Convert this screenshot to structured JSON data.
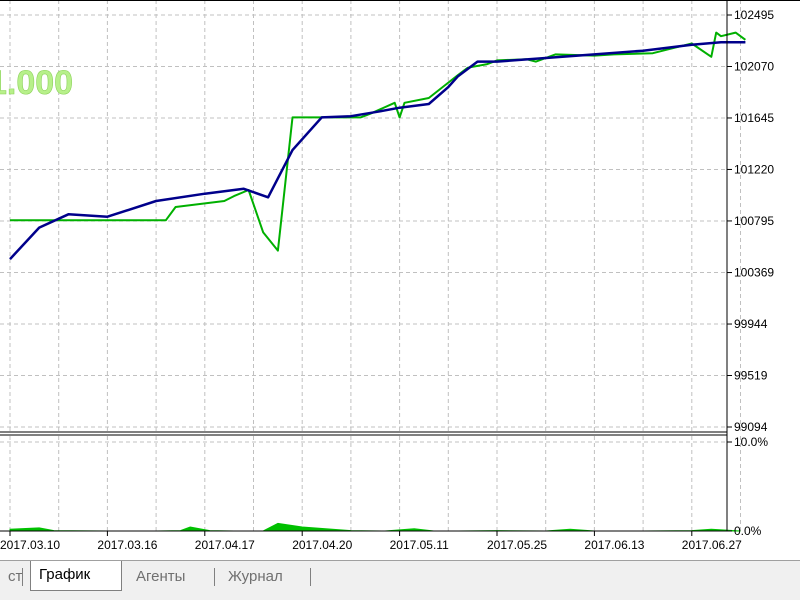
{
  "chart_data": {
    "type": "line",
    "balance_label": "1.000",
    "y_ticks": [
      "102495",
      "102070",
      "101645",
      "101220",
      "100795",
      "100369",
      "99944",
      "99519",
      "99094"
    ],
    "ylim": [
      99094,
      102495
    ],
    "x_ticks": [
      "2017.03.10",
      "2017.03.16",
      "2017.04.17",
      "2017.04.20",
      "2017.05.11",
      "2017.05.25",
      "2017.06.13",
      "2017.06.27"
    ],
    "series": [
      {
        "color": "#00b000",
        "x": [
          0,
          0.5,
          1.0,
          1.6,
          1.7,
          2.2,
          2.3,
          2.45,
          2.6,
          2.75,
          2.9,
          3.0,
          3.2,
          3.5,
          3.6,
          3.7,
          3.95,
          4.0,
          4.05,
          4.3,
          4.6,
          4.7,
          4.9,
          5.0,
          5.3,
          5.4,
          5.6,
          6.0,
          6.2,
          6.6,
          6.8,
          7.0,
          7.2,
          7.25,
          7.3,
          7.45,
          7.55
        ],
        "y": [
          100800,
          100800,
          100800,
          100800,
          100910,
          100960,
          101000,
          101050,
          100700,
          100550,
          101650,
          101650,
          101650,
          101650,
          101650,
          101680,
          101770,
          101650,
          101770,
          101810,
          102000,
          102060,
          102090,
          102120,
          102130,
          102110,
          102170,
          102160,
          102170,
          102180,
          102220,
          102260,
          102150,
          102350,
          102320,
          102350,
          102290
        ]
      },
      {
        "color": "#00008b",
        "x": [
          0,
          0.3,
          0.6,
          1.0,
          1.5,
          2.0,
          2.4,
          2.65,
          2.9,
          3.2,
          3.5,
          3.8,
          4.0,
          4.3,
          4.5,
          4.6,
          4.8,
          5.0,
          5.5,
          6.0,
          6.5,
          7.0,
          7.3,
          7.55
        ],
        "y": [
          100480,
          100740,
          100850,
          100830,
          100960,
          101020,
          101060,
          100990,
          101380,
          101650,
          101660,
          101700,
          101730,
          101760,
          101900,
          101990,
          102110,
          102110,
          102140,
          102170,
          102200,
          102250,
          102270,
          102270
        ]
      }
    ],
    "drawdown": {
      "y_ticks": [
        "10.0%",
        "0.0%"
      ],
      "ylim": [
        0,
        10
      ],
      "color": "#00c000",
      "x": [
        0,
        0.3,
        0.45,
        1.0,
        1.5,
        1.75,
        1.85,
        2.05,
        2.3,
        2.6,
        2.75,
        3.0,
        3.5,
        3.85,
        4.15,
        4.35,
        4.6,
        5.0,
        5.5,
        5.75,
        6.0,
        6.5,
        7.0,
        7.2,
        7.5
      ],
      "y": [
        0.2,
        0.35,
        0.05,
        0.0,
        0.0,
        0.05,
        0.45,
        0.05,
        0.0,
        0.0,
        0.85,
        0.45,
        0.05,
        0.0,
        0.25,
        0.0,
        0.0,
        0.05,
        0.0,
        0.2,
        0.0,
        0.0,
        0.05,
        0.2,
        0.0
      ]
    }
  },
  "tabs": [
    {
      "label": "ст",
      "active": false
    },
    {
      "label": "График",
      "active": true
    },
    {
      "label": "Агенты",
      "active": false
    },
    {
      "label": "Журнал",
      "active": false
    }
  ]
}
